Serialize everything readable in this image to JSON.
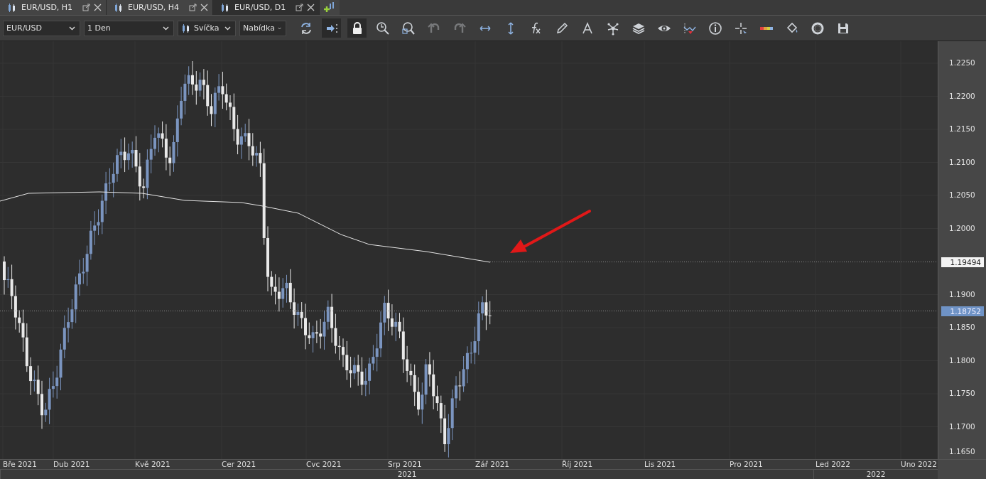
{
  "tabs": [
    {
      "label": "EUR/USD, H1",
      "selected": false
    },
    {
      "label": "EUR/USD, H4",
      "selected": false
    },
    {
      "label": "EUR/USD, D1",
      "selected": true
    }
  ],
  "toolbar": {
    "selects": [
      {
        "kind": "symbol",
        "value": "EUR/USD"
      },
      {
        "kind": "period",
        "value": "1 Den"
      },
      {
        "kind": "charttype",
        "value": "Svíčka"
      },
      {
        "kind": "price",
        "value": "Nabídka"
      }
    ],
    "tools": [
      {
        "kind": "refresh",
        "pressed": false,
        "disabled": false
      },
      {
        "kind": "shift",
        "pressed": true,
        "disabled": false
      },
      {
        "kind": "lock",
        "pressed": true,
        "disabled": false
      },
      {
        "kind": "zoom",
        "pressed": false,
        "disabled": false
      },
      {
        "kind": "zoombox",
        "pressed": false,
        "disabled": false
      },
      {
        "kind": "undo",
        "pressed": false,
        "disabled": true
      },
      {
        "kind": "redo",
        "pressed": false,
        "disabled": true
      },
      {
        "kind": "hscale",
        "pressed": false,
        "disabled": false
      },
      {
        "kind": "vscale",
        "pressed": false,
        "disabled": false
      },
      {
        "kind": "fx",
        "pressed": false,
        "disabled": false
      },
      {
        "kind": "pencil",
        "pressed": false,
        "disabled": false
      },
      {
        "kind": "text",
        "pressed": false,
        "disabled": false
      },
      {
        "kind": "network",
        "pressed": false,
        "disabled": false
      },
      {
        "kind": "layers",
        "pressed": false,
        "disabled": false
      },
      {
        "kind": "eye",
        "pressed": false,
        "disabled": false
      },
      {
        "kind": "wave",
        "pressed": false,
        "disabled": false
      },
      {
        "kind": "info",
        "pressed": false,
        "disabled": false
      },
      {
        "kind": "crosshair",
        "pressed": false,
        "disabled": false
      },
      {
        "kind": "colors",
        "pressed": false,
        "disabled": false
      },
      {
        "kind": "bucket",
        "pressed": false,
        "disabled": false
      },
      {
        "kind": "ring",
        "pressed": false,
        "disabled": false
      },
      {
        "kind": "save",
        "pressed": false,
        "disabled": false
      }
    ]
  },
  "price_axis": {
    "ticks": [
      "1.2250",
      "1.2200",
      "1.2150",
      "1.2100",
      "1.2050",
      "1.2000",
      "1.1900",
      "1.1850",
      "1.1800",
      "1.1750",
      "1.1700",
      "1.1650"
    ],
    "markers": [
      {
        "kind": "indicator",
        "text": "1.19494"
      },
      {
        "kind": "last",
        "text": "1.18752"
      }
    ]
  },
  "time_axis": {
    "months": [
      "Bře 2021",
      "Dub 2021",
      "Kvě 2021",
      "Cer 2021",
      "Cvc 2021",
      "Srp 2021",
      "Zář 2021",
      "Říj 2021",
      "Lis 2021",
      "Pro 2021",
      "Led 2022",
      "Uno 2022"
    ],
    "years": [
      "2021",
      "2022"
    ]
  }
}
